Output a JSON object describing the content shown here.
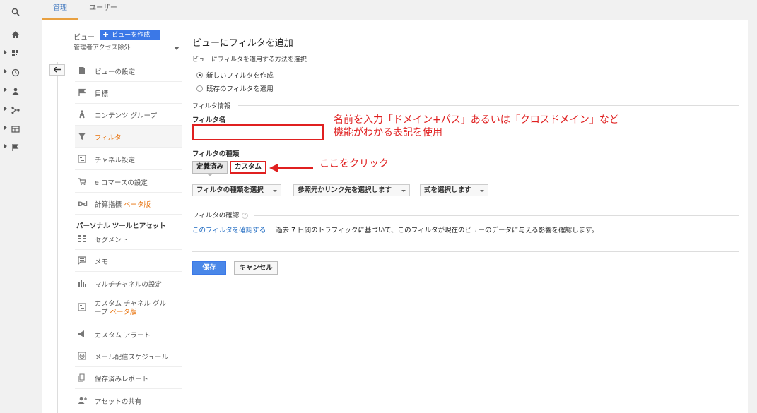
{
  "tabs": [
    "管理",
    "ユーザー"
  ],
  "rail": {
    "icons": [
      "search-icon",
      "home-icon",
      "dashboard-icon",
      "clock-icon",
      "person-icon",
      "acquisition-icon",
      "behavior-icon",
      "flag-icon"
    ]
  },
  "view": {
    "label": "ビュー",
    "create_button": "ビューを作成",
    "selected": "管理者アクセス除外"
  },
  "nav": {
    "items": [
      {
        "label": "ビューの設定",
        "icon": "document-icon"
      },
      {
        "label": "目標",
        "icon": "flag-icon"
      },
      {
        "label": "コンテンツ グループ",
        "icon": "person-walk-icon"
      },
      {
        "label": "フィルタ",
        "icon": "filter-icon"
      },
      {
        "label": "チャネル設定",
        "icon": "channel-icon"
      },
      {
        "label": "e コマースの設定",
        "icon": "cart-icon"
      },
      {
        "label": "計算指標 ",
        "beta": "ベータ版",
        "icon": "dd-icon"
      }
    ],
    "personal_section": "パーソナル ツールとアセット",
    "personal_items": [
      {
        "label": "セグメント",
        "icon": "segment-icon"
      },
      {
        "label": "メモ",
        "icon": "note-icon"
      },
      {
        "label": "マルチチャネルの設定",
        "icon": "bar-chart-icon"
      },
      {
        "label": "カスタム チャネル グル",
        "label2": "ープ ",
        "beta": "ベータ版",
        "icon": "channel-icon"
      },
      {
        "label": "カスタム アラート",
        "icon": "megaphone-icon"
      },
      {
        "label": "メール配信スケジュール",
        "icon": "alarm-icon"
      },
      {
        "label": "保存済みレポート",
        "icon": "saved-report-icon"
      },
      {
        "label": "アセットの共有",
        "icon": "add-user-icon"
      }
    ]
  },
  "content": {
    "title": "ビューにフィルタを追加",
    "apply_method_heading": "ビューにフィルタを適用する方法を選択",
    "radio_new": "新しいフィルタを作成",
    "radio_existing": "既存のフィルタを適用",
    "info_heading": "フィルタ情報",
    "name_label": "フィルタ名",
    "name_value": "",
    "type_label": "フィルタの種類",
    "type_predefined": "定義済み",
    "type_custom": "カスタム",
    "dd_filter_type": "フィルタの種類を選択",
    "dd_source": "参照元かリンク先を選択します",
    "dd_expression": "式を選択します",
    "verify_heading": "フィルタの確認",
    "verify_link": "このフィルタを確認する",
    "verify_text": "過去 7 日間のトラフィックに基づいて、このフィルタが現在のビューのデータに与える影響を確認します。",
    "save": "保存",
    "cancel": "キャンセル"
  },
  "annotations": {
    "name_note_line1": "名前を入力「ドメイン+パス」あるいは「クロスドメイン」など",
    "name_note_line2": "機能がわかる表記を使用",
    "click_note": "ここをクリック",
    "color": "#e02020"
  }
}
